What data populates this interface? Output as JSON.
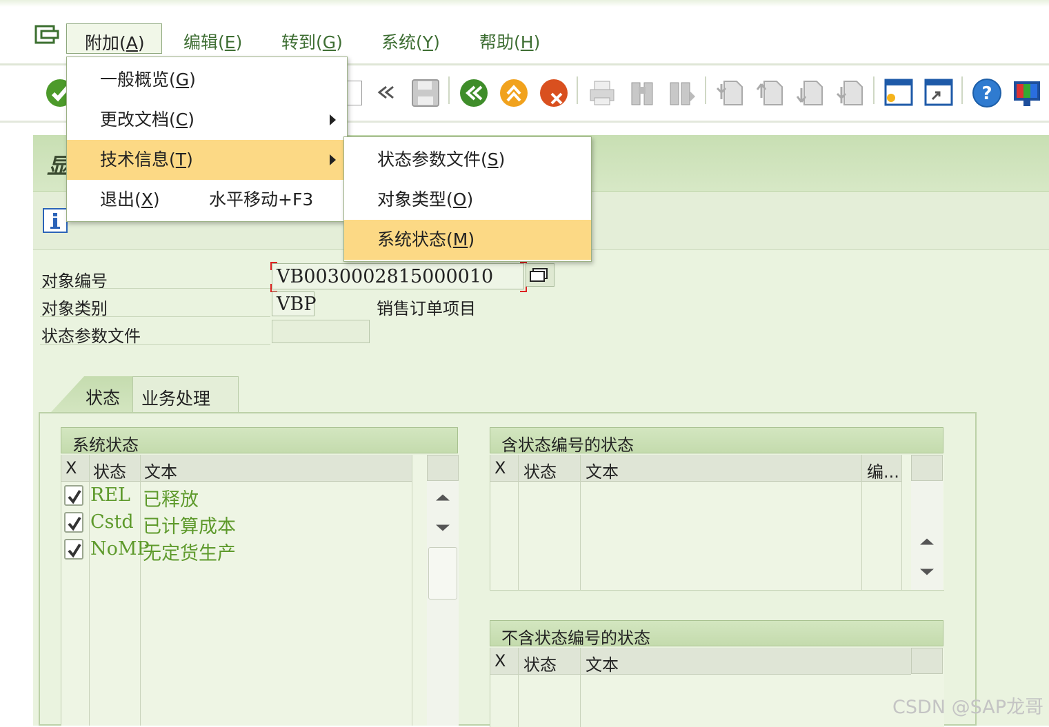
{
  "menubar": {
    "items": [
      {
        "label": "附加",
        "key": "A"
      },
      {
        "label": "编辑",
        "key": "E"
      },
      {
        "label": "转到",
        "key": "G"
      },
      {
        "label": "系统",
        "key": "Y"
      },
      {
        "label": "帮助",
        "key": "H"
      }
    ]
  },
  "extras_menu": {
    "items": [
      {
        "label": "一般概览",
        "key": "G",
        "submenu": false
      },
      {
        "label": "更改文档",
        "key": "C",
        "submenu": true
      },
      {
        "label": "技术信息",
        "key": "T",
        "submenu": true,
        "highlighted": true
      },
      {
        "label": "退出",
        "key": "X",
        "shortcut": "水平移动+F3"
      }
    ]
  },
  "tech_info_submenu": {
    "items": [
      {
        "label": "状态参数文件",
        "key": "S"
      },
      {
        "label": "对象类型",
        "key": "O"
      },
      {
        "label": "系统状态",
        "key": "M",
        "highlighted": true
      }
    ]
  },
  "window_title_partial": "显",
  "form": {
    "object_number_label": "对象编号",
    "object_number_value": "VB0030002815000010",
    "object_type_label": "对象类别",
    "object_type_value": "VBP",
    "object_type_text": "销售订单项目",
    "status_profile_label": "状态参数文件",
    "status_profile_value": ""
  },
  "tabs": [
    {
      "label": "状态",
      "active": true
    },
    {
      "label": "业务处理",
      "active": false
    }
  ],
  "system_status": {
    "title": "系统状态",
    "columns": [
      "X",
      "状态",
      "文本"
    ],
    "rows": [
      {
        "checked": true,
        "status": "REL",
        "text": "已释放"
      },
      {
        "checked": true,
        "status": "Cstd",
        "text": "已计算成本"
      },
      {
        "checked": true,
        "status": "NoMP",
        "text": "无定货生产"
      }
    ]
  },
  "user_status_with_no": {
    "title": "含状态编号的状态",
    "columns": [
      "X",
      "状态",
      "文本",
      "编..."
    ]
  },
  "user_status_without_no": {
    "title": "不含状态编号的状态",
    "columns": [
      "X",
      "状态",
      "文本"
    ]
  },
  "watermark": "CSDN @SAP龙哥",
  "colors": {
    "highlight": "#fcd985",
    "status_text": "#5e9a2c",
    "menu_text": "#3e6e33"
  }
}
